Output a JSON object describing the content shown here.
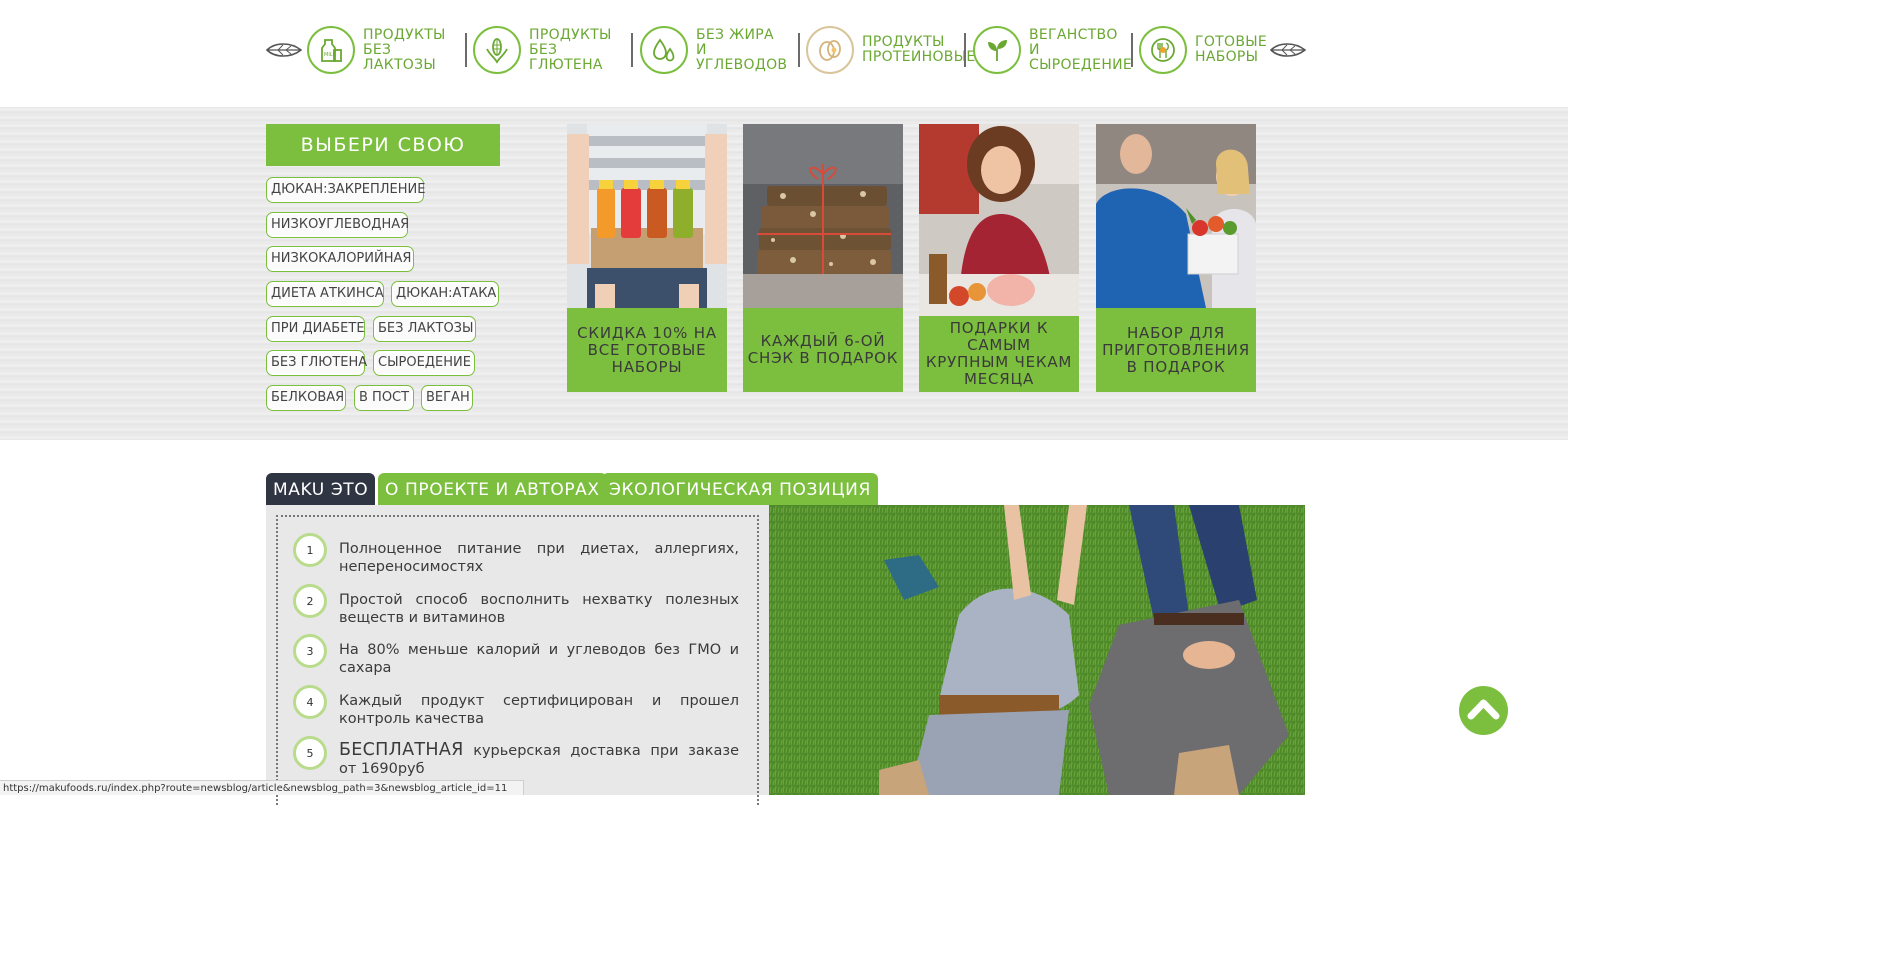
{
  "nav": {
    "categories": [
      {
        "line1": "ПРОДУКТЫ",
        "line2": "БЕЗ ЛАКТОЗЫ",
        "icon": "milk-icon"
      },
      {
        "line1": "ПРОДУКТЫ",
        "line2": "БЕЗ ГЛЮТЕНА",
        "icon": "corn-icon"
      },
      {
        "line1": "БЕЗ ЖИРА И",
        "line2": "УГЛЕВОДОВ",
        "icon": "drops-icon"
      },
      {
        "line1": "ПРОДУКТЫ",
        "line2": "ПРОТЕИНОВЫЕ",
        "icon": "eggs-icon"
      },
      {
        "line1": "ВЕГАНСТВО И",
        "line2": "СЫРОЕДЕНИЕ",
        "icon": "leaves-icon"
      },
      {
        "line1": "ГОТОВЫЕ",
        "line2": "НАБОРЫ",
        "icon": "plate-fork-icon"
      }
    ]
  },
  "diet": {
    "title": "ВЫБЕРИ СВОЮ ДИЕТУ",
    "tags": [
      "ДЮКАН:ЗАКРЕПЛЕНИЕ",
      "НИЗКОУГЛЕВОДНАЯ",
      "НИЗКОКАЛОРИЙНАЯ",
      "ДИЕТА АТКИНСА",
      "ДЮКАН:АТАКА",
      "ПРИ ДИАБЕТЕ",
      "БЕЗ ЛАКТОЗЫ",
      "БЕЗ ГЛЮТЕНА",
      "СЫРОЕДЕНИЕ",
      "БЕЛКОВАЯ",
      "В ПОСТ",
      "ВЕГАН"
    ]
  },
  "promos": [
    {
      "caption": "СКИДКА 10% НА ВСЕ ГОТОВЫЕ НАБОРЫ"
    },
    {
      "caption": "КАЖДЫЙ 6-ОЙ СНЭК В ПОДАРОК"
    },
    {
      "caption": "ПОДАРКИ К САМЫМ КРУПНЫМ ЧЕКАМ МЕСЯЦА"
    },
    {
      "caption": "НАБОР ДЛЯ ПРИГОТОВЛЕНИЯ В ПОДАРОК"
    }
  ],
  "tabs": [
    "MAKU ЭТО",
    "О ПРОЕКТЕ И АВТОРАХ",
    "ЭКОЛОГИЧЕСКАЯ ПОЗИЦИЯ"
  ],
  "features": [
    {
      "num": "1",
      "text": "Полноценное питание при диетах, аллергиях, непереносимостях"
    },
    {
      "num": "2",
      "text": "Простой способ восполнить нехватку полезных веществ и витаминов"
    },
    {
      "num": "3",
      "text": "На 80% меньше калорий и углеводов без ГМО и сахара"
    },
    {
      "num": "4",
      "text": "Каждый продукт сертифицирован и прошел контроль качества"
    },
    {
      "num": "5",
      "highlight": "БЕСПЛАТНАЯ",
      "text": " курьерская доставка при заказе от 1690руб"
    }
  ],
  "status_url": "https://makufoods.ru/index.php?route=newsblog/article&newsblog_path=3&newsblog_article_id=11",
  "colors": {
    "accent": "#7cbf3f",
    "tab_dark": "#2f3543"
  }
}
